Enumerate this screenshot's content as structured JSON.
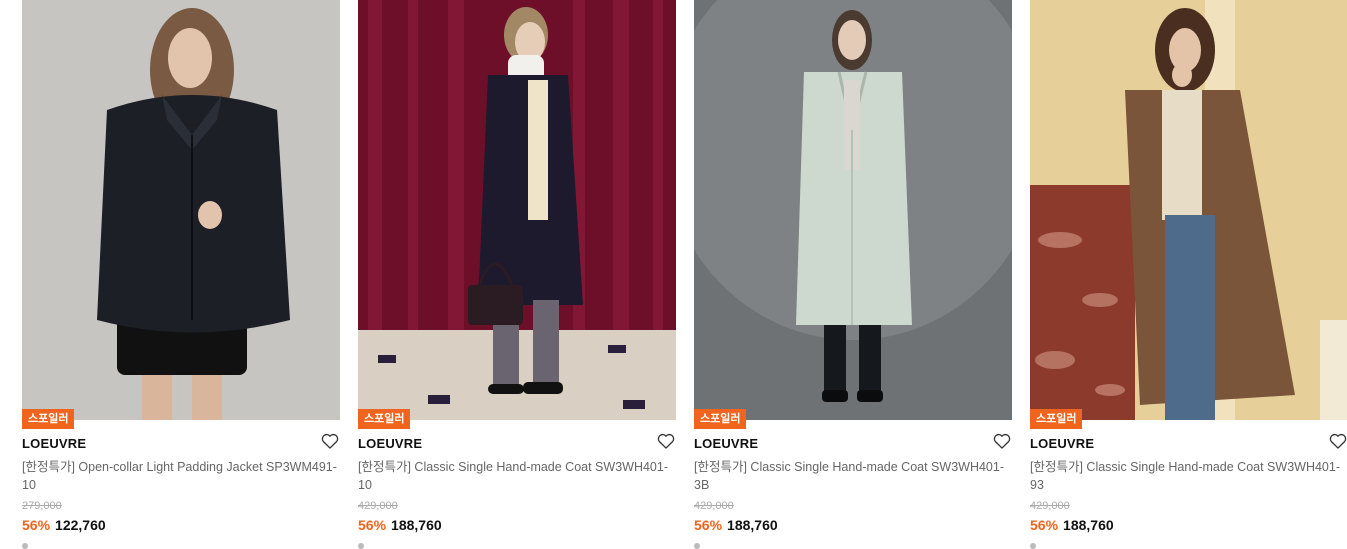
{
  "products": [
    {
      "badge": "스포일러",
      "brand": "LOEUVRE",
      "name": "[한정특가] Open-collar Light Padding Jacket SP3WM491-10",
      "original_price": "279,000",
      "discount": "56%",
      "price": "122,760",
      "image": "model-black-padding-jacket"
    },
    {
      "badge": "스포일러",
      "brand": "LOEUVRE",
      "name": "[한정특가] Classic Single Hand-made Coat SW3WH401-10",
      "original_price": "429,000",
      "discount": "56%",
      "price": "188,760",
      "image": "model-navy-coat-red-curtain"
    },
    {
      "badge": "스포일러",
      "brand": "LOEUVRE",
      "name": "[한정특가] Classic Single Hand-made Coat SW3WH401-3B",
      "original_price": "429,000",
      "discount": "56%",
      "price": "188,760",
      "image": "model-mint-coat-grey-backdrop"
    },
    {
      "badge": "스포일러",
      "brand": "LOEUVRE",
      "name": "[한정특가] Classic Single Hand-made Coat SW3WH401-93",
      "original_price": "429,000",
      "discount": "56%",
      "price": "188,760",
      "image": "model-brown-coat-marble-wall"
    }
  ],
  "colors": {
    "badge": "#f0641e",
    "discount": "#f0641e",
    "original_price": "#aaaaaa",
    "product_name": "#666666"
  },
  "icons": {
    "wishlist": "heart-outline-icon"
  }
}
